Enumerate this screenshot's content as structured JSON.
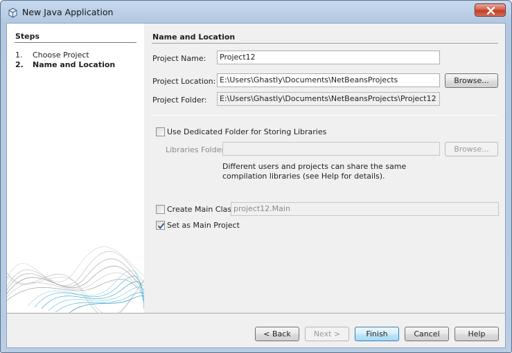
{
  "window": {
    "title": "New Java Application",
    "icon": "java-cup-icon",
    "close_icon": "close-icon"
  },
  "steps": {
    "title": "Steps",
    "items": [
      {
        "num": "1.",
        "label": "Choose Project",
        "current": false
      },
      {
        "num": "2.",
        "label": "Name and Location",
        "current": true
      }
    ]
  },
  "form": {
    "section_title": "Name and Location",
    "project_name": {
      "label": "Project Name:",
      "value": "Project12"
    },
    "project_location": {
      "label": "Project Location:",
      "value": "E:\\Users\\Ghastly\\Documents\\NetBeansProjects",
      "browse": "Browse..."
    },
    "project_folder": {
      "label": "Project Folder:",
      "value": "E:\\Users\\Ghastly\\Documents\\NetBeansProjects\\Project12"
    },
    "dedicated_folder": {
      "label": "Use Dedicated Folder for Storing Libraries",
      "checked": false
    },
    "libraries_folder": {
      "label": "Libraries Folder:",
      "value": "",
      "browse": "Browse..."
    },
    "help_text": "Different users and projects can share the same compilation libraries (see Help for details).",
    "create_main_class": {
      "label": "Create Main Class",
      "checked": false,
      "value": "project12.Main"
    },
    "set_main_project": {
      "label": "Set as Main Project",
      "checked": true
    }
  },
  "buttons": {
    "back": "< Back",
    "next": "Next >",
    "finish": "Finish",
    "cancel": "Cancel",
    "help": "Help"
  }
}
